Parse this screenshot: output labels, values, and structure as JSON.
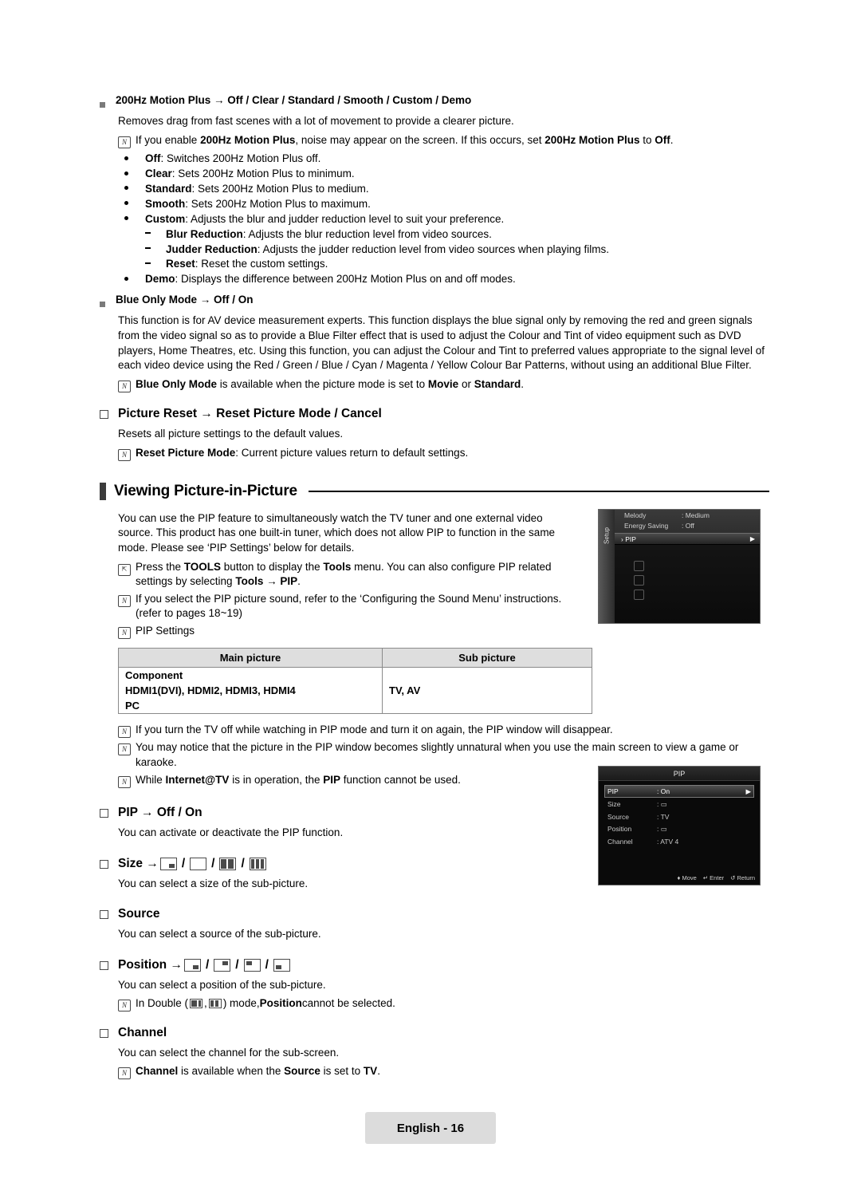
{
  "top_section": {
    "heading": "200Hz Motion Plus → Off / Clear / Standard / Smooth / Custom / Demo",
    "description": "Removes drag from fast scenes with a lot of movement to provide a clearer picture.",
    "note1_parts": [
      "If you enable ",
      "200Hz Motion Plus",
      ", noise may appear on the screen. If this occurs, set ",
      "200Hz Motion Plus",
      " to ",
      "Off",
      "."
    ],
    "items": [
      {
        "term": "Off",
        "text": ": Switches 200Hz Motion Plus off."
      },
      {
        "term": "Clear",
        "text": ": Sets 200Hz Motion Plus to minimum."
      },
      {
        "term": "Standard",
        "text": ": Sets 200Hz Motion Plus to medium."
      },
      {
        "term": "Smooth",
        "text": ": Sets 200Hz Motion Plus to maximum."
      },
      {
        "term": "Custom",
        "text": ": Adjusts the blur and judder reduction level to suit your preference."
      }
    ],
    "subitems": [
      {
        "term": "Blur Reduction",
        "text": ": Adjusts the blur reduction level from video sources."
      },
      {
        "term": "Judder Reduction",
        "text": ": Adjusts the judder reduction level from video sources when playing films."
      },
      {
        "term": "Reset",
        "text": ": Reset the custom settings."
      }
    ],
    "demo": {
      "term": "Demo",
      "text": ": Displays the difference between 200Hz Motion Plus on and off modes."
    }
  },
  "blue_only": {
    "heading": "Blue Only Mode → Off / On",
    "body": "This function is for AV device measurement experts. This function displays the blue signal only by removing the red and green signals from the video signal so as to provide a Blue Filter effect that is used to adjust the Colour and Tint of video equipment such as DVD players, Home Theatres, etc. Using this function, you can adjust the Colour and Tint to preferred values appropriate to the signal level of each video device using the Red / Green / Blue / Cyan / Magenta / Yellow Colour Bar Patterns, without using an additional Blue Filter.",
    "note_parts": [
      "Blue Only Mode",
      " is available when the picture mode is set to ",
      "Movie",
      " or ",
      "Standard",
      "."
    ]
  },
  "picture_reset": {
    "heading": "Picture Reset → Reset Picture Mode / Cancel",
    "body": "Resets all picture settings to the default values.",
    "note_parts": [
      "Reset Picture Mode",
      ": Current picture values return to default settings."
    ]
  },
  "pip_section": {
    "title": "Viewing Picture-in-Picture",
    "intro": "You can use the PIP feature to simultaneously watch the TV tuner and one external video source. This product has one built-in tuner, which does not allow PIP to function in the same mode. Please see ‘PIP Settings’ below for details.",
    "note_tools_parts": [
      "Press the ",
      "TOOLS",
      " button to display the ",
      "Tools",
      " menu. You can also configure PIP related settings by selecting ",
      "Tools",
      " → ",
      "PIP",
      "."
    ],
    "note_sound": "If you select the PIP picture sound, refer to the ‘Configuring the Sound Menu’ instructions. (refer to pages 18~19)",
    "note_settings": "PIP Settings",
    "table": {
      "headers": [
        "Main picture",
        "Sub picture"
      ],
      "rows": [
        {
          "main": "Component",
          "sub": ""
        },
        {
          "main": "HDMI1(DVI), HDMI2, HDMI3, HDMI4",
          "sub": "TV, AV"
        },
        {
          "main": "PC",
          "sub": ""
        }
      ]
    },
    "notes_after": [
      "If you turn the TV off while watching in PIP mode and turn it on again, the PIP window will disappear.",
      "You may notice that the picture in the PIP window becomes slightly unnatural when you use the main screen to view a game or karaoke."
    ],
    "note_internet_parts": [
      "While ",
      "Internet@TV",
      " is in operation, the ",
      "PIP",
      " function cannot be used."
    ]
  },
  "pip_items": [
    {
      "heading": "PIP → Off / On",
      "body": "You can activate or deactivate the PIP function."
    },
    {
      "heading": "Size → ",
      "body": "You can select a size of the sub-picture."
    },
    {
      "heading": "Source",
      "body": "You can select a source of the sub-picture."
    },
    {
      "heading": "Position → ",
      "body": "You can select a position of the sub-picture.",
      "note_parts": [
        "In Double (",
        ", ",
        ") mode, ",
        "Position",
        " cannot be selected."
      ]
    },
    {
      "heading": "Channel",
      "body": "You can select the channel for the sub-screen.",
      "note_parts": [
        "Channel",
        " is available when the ",
        "Source",
        " is set to ",
        "TV",
        "."
      ]
    }
  ],
  "osd_tools": {
    "tab_label": "Setup",
    "rows": [
      {
        "key": "Melody",
        "value": ": Medium",
        "selected": false
      },
      {
        "key": "Energy Saving",
        "value": ": Off",
        "selected": false
      },
      {
        "key": "PIP",
        "value": "",
        "selected": true,
        "arrow": "▶"
      }
    ]
  },
  "osd_pip": {
    "title": "PIP",
    "rows": [
      {
        "key": "PIP",
        "value": ": On",
        "selected": true,
        "arrow": "▶"
      },
      {
        "key": "Size",
        "value": ": ▭",
        "selected": false
      },
      {
        "key": "Source",
        "value": ": TV",
        "selected": false
      },
      {
        "key": "Position",
        "value": ": ▭",
        "selected": false
      },
      {
        "key": "Channel",
        "value": ": ATV 4",
        "selected": false
      }
    ],
    "footer": [
      "♦ Move",
      "↵ Enter",
      "↺ Return"
    ]
  },
  "footer": {
    "page_label": "English - 16"
  }
}
